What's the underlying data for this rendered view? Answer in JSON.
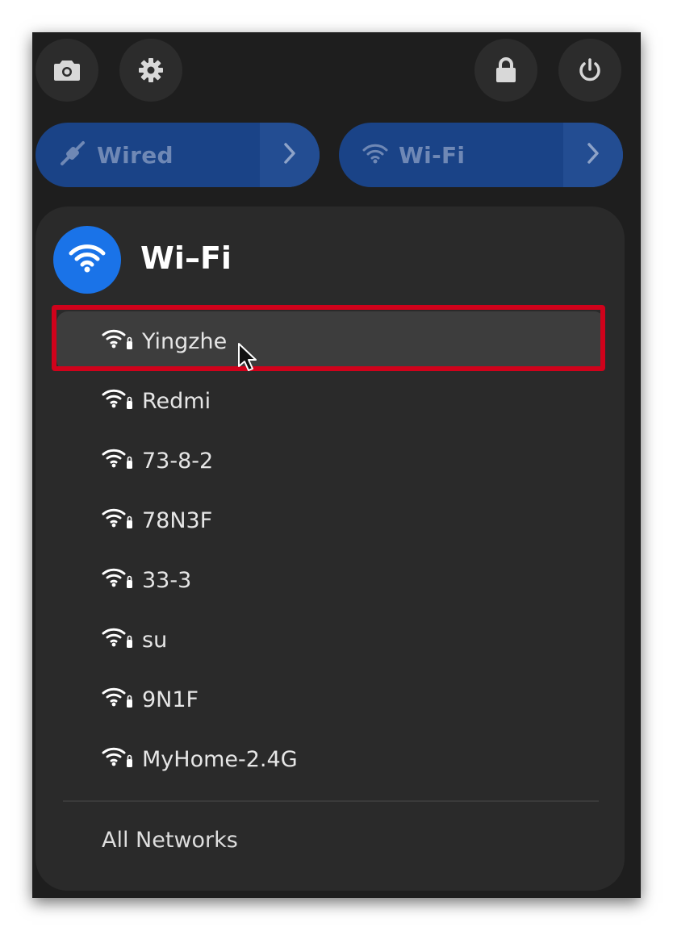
{
  "quick_settings": {
    "top_buttons": [
      {
        "name": "screenshot",
        "icon": "camera-icon"
      },
      {
        "name": "settings",
        "icon": "gear-icon"
      },
      {
        "name": "lock",
        "icon": "lock-icon"
      },
      {
        "name": "power",
        "icon": "power-icon"
      }
    ],
    "toggles": {
      "wired": {
        "label": "Wired",
        "icon": "wired-network-icon"
      },
      "wifi": {
        "label": "Wi-Fi",
        "icon": "wifi-icon"
      }
    }
  },
  "wifi_menu": {
    "title": "Wi–Fi",
    "networks": [
      {
        "name": "Yingzhe",
        "icon": "wifi-signal-icon",
        "hovered": true
      },
      {
        "name": "Redmi",
        "icon": "wifi-signal-icon"
      },
      {
        "name": "73-8-2",
        "icon": "wifi-signal-icon"
      },
      {
        "name": "78N3F",
        "icon": "wifi-signal-icon"
      },
      {
        "name": "33-3",
        "icon": "wifi-signal-icon"
      },
      {
        "name": "su",
        "icon": "wifi-signal-icon"
      },
      {
        "name": "9N1F",
        "icon": "wifi-signal-icon"
      },
      {
        "name": "MyHome-2.4G",
        "icon": "wifi-signal-icon"
      }
    ],
    "all_networks_label": "All Networks"
  },
  "colors": {
    "accent": "#1a73e8",
    "toggle_bg": "#1a4387",
    "highlight": "#d0021b",
    "panel_bg": "#1e1e1e",
    "menu_bg": "#2a2a2a"
  }
}
